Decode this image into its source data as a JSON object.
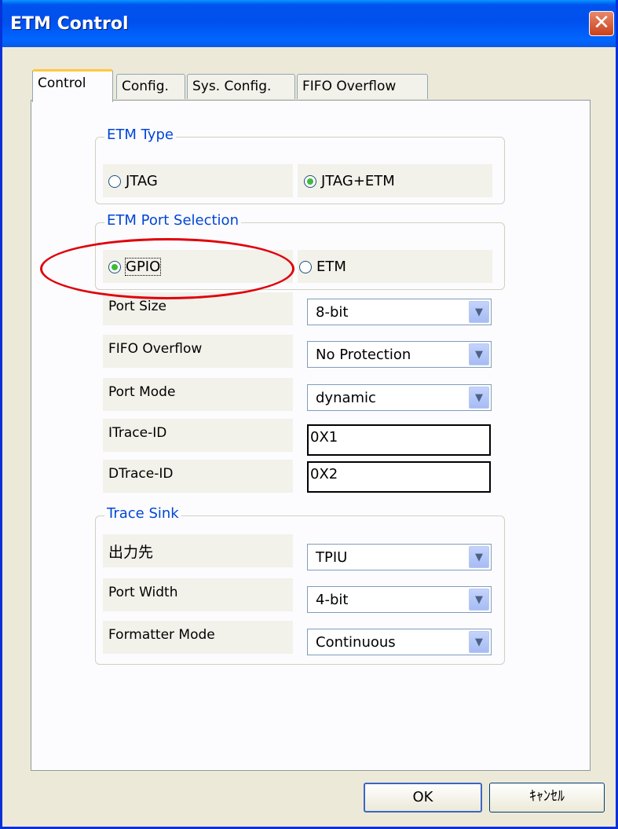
{
  "window": {
    "title": "ETM Control",
    "close_glyph": "✕"
  },
  "tabs": [
    {
      "label": "Control",
      "active": true
    },
    {
      "label": "Config.",
      "active": false
    },
    {
      "label": "Sys. Config.",
      "active": false
    },
    {
      "label": "FIFO Overflow",
      "active": false
    }
  ],
  "etm_type": {
    "label": "ETM Type",
    "options": [
      {
        "label": "JTAG",
        "selected": false
      },
      {
        "label": "JTAG+ETM",
        "selected": true
      }
    ]
  },
  "etm_port_selection": {
    "label": "ETM Port Selection",
    "options": [
      {
        "label": "GPIO",
        "selected": true
      },
      {
        "label": "ETM",
        "selected": false
      }
    ]
  },
  "settings": {
    "port_size": {
      "label": "Port Size",
      "value": "8-bit"
    },
    "fifo_overflow": {
      "label": "FIFO Overflow",
      "value": "No Protection"
    },
    "port_mode": {
      "label": "Port Mode",
      "value": "dynamic"
    },
    "itrace_id": {
      "label": "ITrace-ID",
      "value": "0X1"
    },
    "dtrace_id": {
      "label": "DTrace-ID",
      "value": "0X2"
    }
  },
  "trace_sink": {
    "label": "Trace Sink",
    "output": {
      "label": "出力先",
      "value": "TPIU"
    },
    "port_width": {
      "label": "Port Width",
      "value": "4-bit"
    },
    "formatter_mode": {
      "label": "Formatter Mode",
      "value": "Continuous"
    }
  },
  "buttons": {
    "ok": "OK",
    "cancel": "ｷｬﾝｾﾙ"
  },
  "icons": {
    "dropdown": "chevron-down-icon",
    "close": "close-icon"
  },
  "colors": {
    "titlebar": "#0054e3",
    "annotation": "#e0000b",
    "group_label": "#0046d5"
  }
}
